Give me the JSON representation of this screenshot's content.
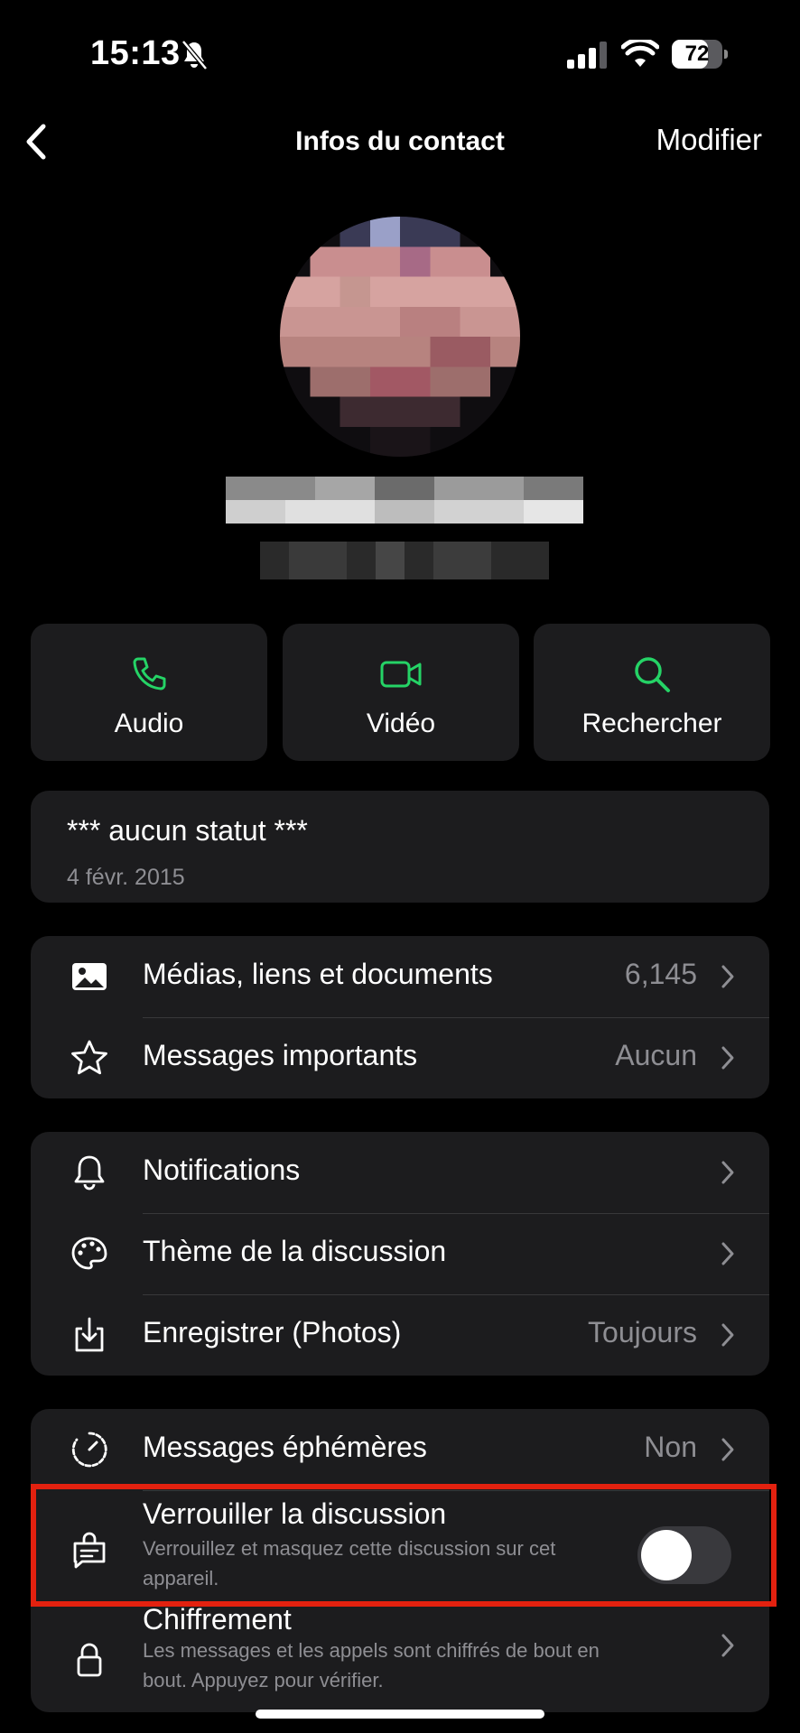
{
  "status_bar": {
    "time": "15:13",
    "battery": "72",
    "battery_level": 0.72
  },
  "nav": {
    "title": "Infos du contact",
    "edit_label": "Modifier"
  },
  "actions": [
    {
      "label": "Audio",
      "icon": "phone-icon"
    },
    {
      "label": "Vidéo",
      "icon": "video-icon"
    },
    {
      "label": "Rechercher",
      "icon": "search-icon"
    }
  ],
  "about": {
    "status": "*** aucun statut ***",
    "date": "4 févr. 2015"
  },
  "media_section": {
    "media": {
      "label": "Médias, liens et documents",
      "value": "6,145",
      "icon": "image-icon"
    },
    "starred": {
      "label": "Messages importants",
      "value": "Aucun",
      "icon": "star-icon"
    }
  },
  "settings_section": {
    "notifications": {
      "label": "Notifications",
      "icon": "bell-icon"
    },
    "theme": {
      "label": "Thème de la discussion",
      "icon": "palette-icon"
    },
    "save": {
      "label": "Enregistrer (Photos)",
      "value": "Toujours",
      "icon": "download-icon"
    }
  },
  "privacy_section": {
    "disappearing": {
      "label": "Messages éphémères",
      "value": "Non",
      "icon": "timer-icon"
    },
    "lock": {
      "title": "Verrouiller la discussion",
      "description": "Verrouillez et masquez cette discussion sur cet appareil.",
      "enabled": false,
      "icon": "chat-lock-icon"
    },
    "encryption": {
      "title": "Chiffrement",
      "description": "Les messages et les appels sont chiffrés de bout en bout. Appuyez pour vérifier.",
      "icon": "lock-icon"
    }
  },
  "colors": {
    "accent": "#25D366",
    "card": "#1c1c1e",
    "highlight": "#e3210f",
    "secondary_text": "#8e8e93"
  }
}
